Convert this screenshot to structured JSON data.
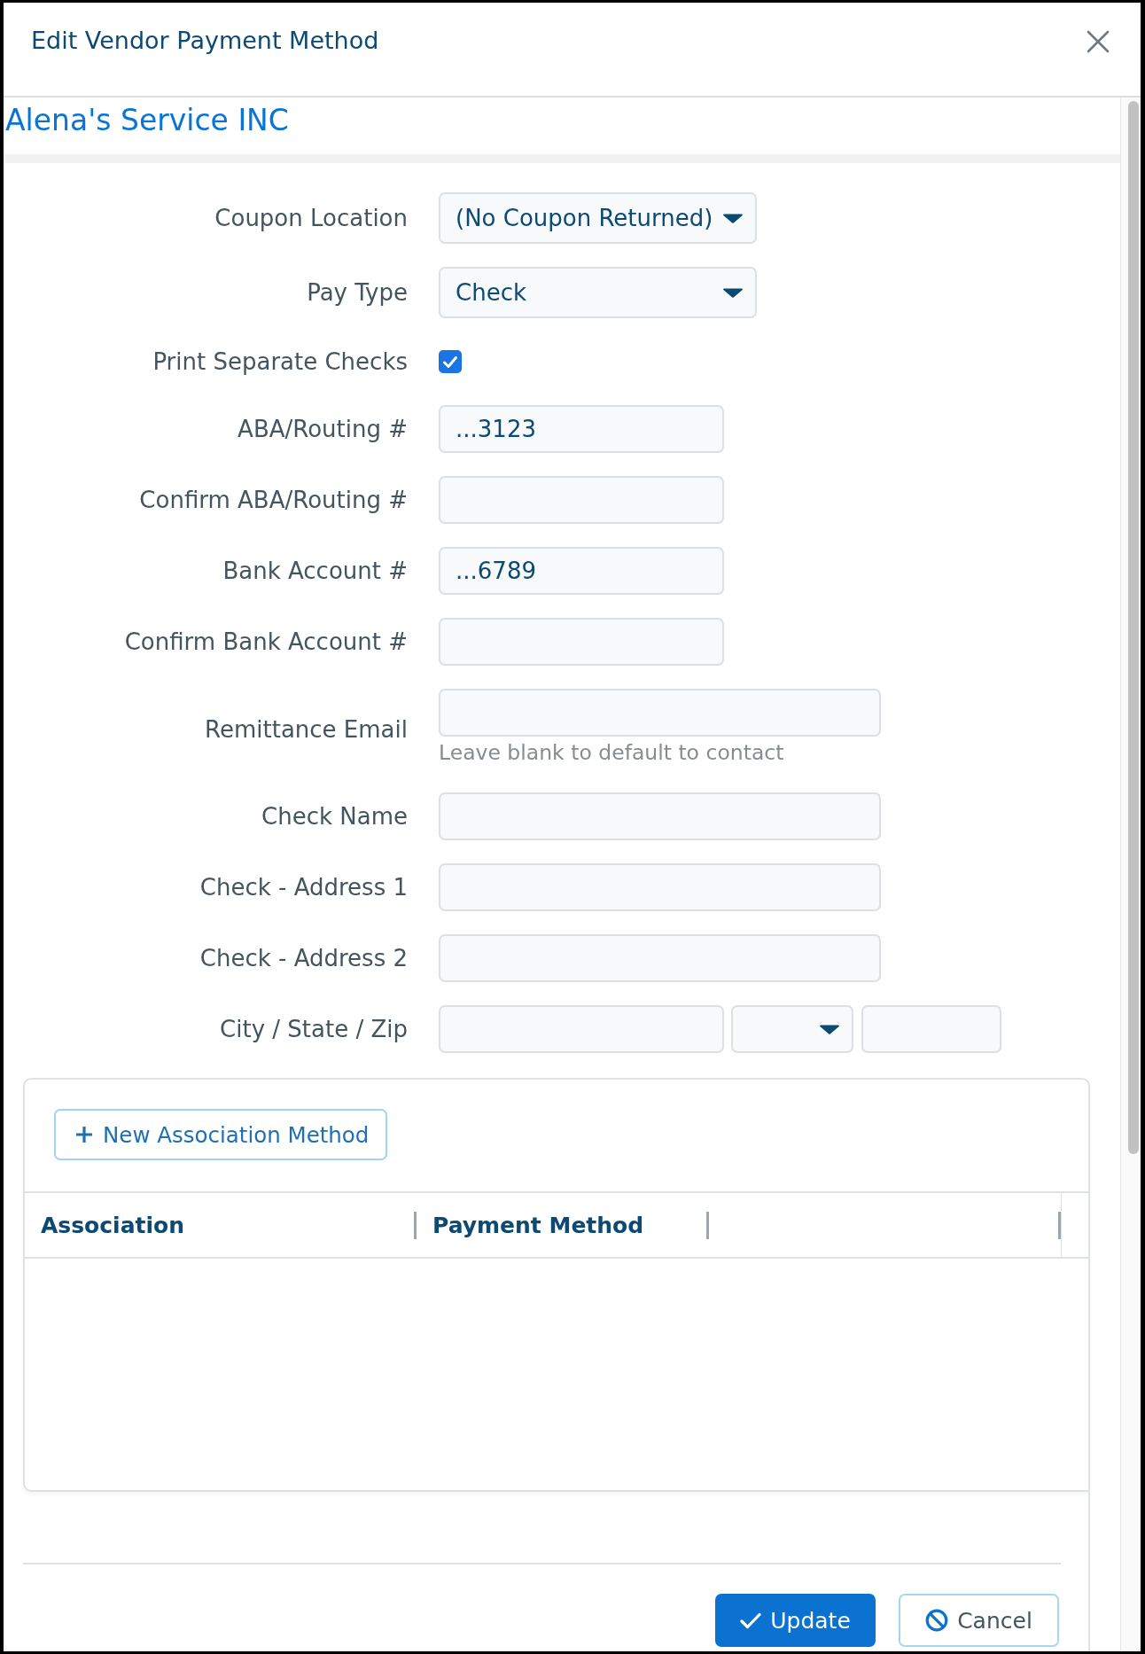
{
  "dialog": {
    "title": "Edit Vendor Payment Method"
  },
  "vendor": {
    "name": "Alena's Service INC"
  },
  "form": {
    "fields": [
      {
        "kind": "select",
        "label": "Coupon Location",
        "value": "(No Coupon Returned)"
      },
      {
        "kind": "select",
        "label": "Pay Type",
        "value": "Check"
      },
      {
        "kind": "checkbox",
        "label": "Print Separate Checks",
        "checked": true
      },
      {
        "kind": "number",
        "label": "ABA/Routing #",
        "value": "...3123"
      },
      {
        "kind": "number",
        "label": "Confirm ABA/Routing #"
      },
      {
        "kind": "number",
        "label": "Bank Account #",
        "value": "...6789"
      },
      {
        "kind": "number",
        "label": "Confirm Bank Account #"
      },
      {
        "kind": "text",
        "label": "Remittance Email",
        "help": "Leave blank to default to contact"
      },
      {
        "kind": "text",
        "label": "Check Name"
      },
      {
        "kind": "text",
        "label": "Check - Address 1"
      },
      {
        "kind": "text",
        "label": "Check - Address 2"
      },
      {
        "kind": "address",
        "label": "City / State / Zip"
      }
    ]
  },
  "associations": {
    "add_button": "New Association Method",
    "columns": [
      {
        "label": "Association"
      },
      {
        "label": "Payment Method"
      }
    ]
  },
  "footer": {
    "buttons": [
      {
        "kind": "confirm",
        "label": "Update"
      },
      {
        "kind": "cancel",
        "label": "Cancel"
      }
    ]
  }
}
